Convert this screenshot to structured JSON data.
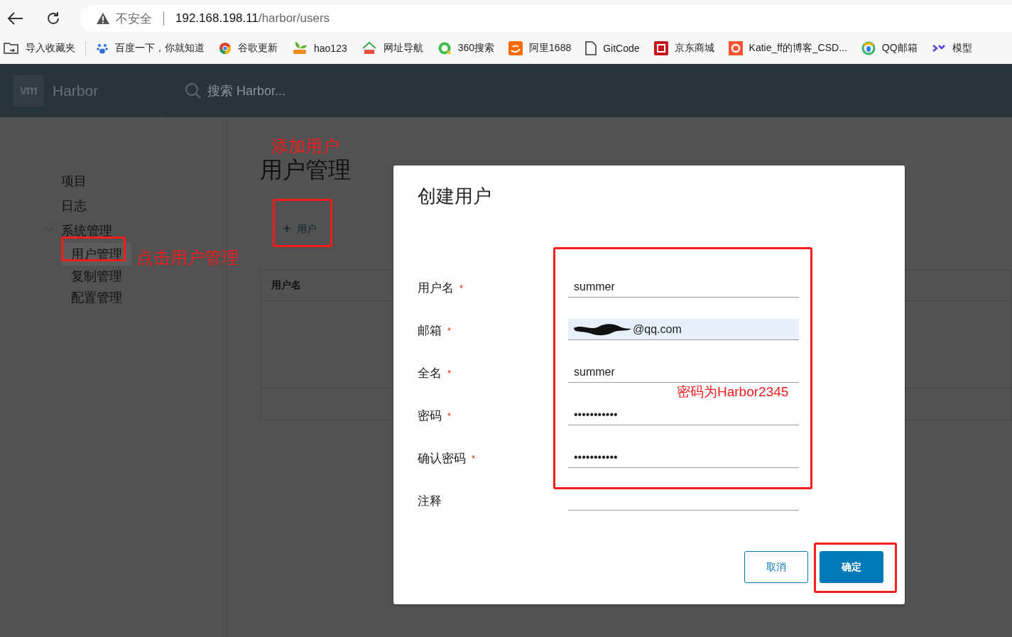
{
  "browser": {
    "address": {
      "warning": "不安全",
      "host": "192.168.198.11",
      "path": "/harbor/users"
    },
    "bookmarks": [
      {
        "label": "导入收藏夹",
        "kind": "folder"
      },
      {
        "label": "百度一下，你就知道",
        "kind": "paw"
      },
      {
        "label": "谷歌更新",
        "kind": "chrome"
      },
      {
        "label": "hao123",
        "kind": "leaf"
      },
      {
        "label": "网址导航",
        "kind": "house"
      },
      {
        "label": "360搜索",
        "kind": "ring"
      },
      {
        "label": "阿里1688",
        "kind": "ali"
      },
      {
        "label": "GitCode",
        "kind": "file"
      },
      {
        "label": "京东商城",
        "kind": "jd"
      },
      {
        "label": "Katie_ff的博客_CSD...",
        "kind": "csdn"
      },
      {
        "label": "QQ邮箱",
        "kind": "qq"
      },
      {
        "label": "模型",
        "kind": "zl"
      }
    ]
  },
  "header": {
    "logo": "vm",
    "brand": "Harbor",
    "search_placeholder": "搜索 Harbor..."
  },
  "sidebar": {
    "items": [
      {
        "label": "项目",
        "selected": false
      },
      {
        "label": "日志",
        "selected": false
      },
      {
        "label": "系统管理",
        "selected": false,
        "expanded": true,
        "children": [
          {
            "label": "用户管理",
            "selected": true
          },
          {
            "label": "复制管理",
            "selected": false
          },
          {
            "label": "配置管理",
            "selected": false
          }
        ]
      }
    ]
  },
  "main": {
    "title": "用户管理",
    "add_button": {
      "icon": "+",
      "label": "用户"
    },
    "table": {
      "columns": [
        "用户名"
      ]
    }
  },
  "dialog": {
    "title": "创建用户",
    "fields": [
      {
        "label": "用户名",
        "required_mark": "*",
        "value": "summer",
        "autofilled": false
      },
      {
        "label": "邮箱",
        "required_mark": "*",
        "value": "@qq.com",
        "autofilled": true,
        "redacted": true
      },
      {
        "label": "全名",
        "required_mark": "*",
        "value": "summer",
        "autofilled": false
      },
      {
        "label": "密码",
        "required_mark": "*",
        "value": "•••••••••••",
        "autofilled": false
      },
      {
        "label": "确认密码",
        "required_mark": "*",
        "value": "•••••••••••",
        "autofilled": false
      },
      {
        "label": "注释",
        "autofilled": false
      }
    ],
    "buttons": [
      {
        "label": "取消",
        "kind": "secondary"
      },
      {
        "label": "确定",
        "kind": "primary"
      }
    ]
  },
  "annotations": [
    {
      "kind": "note",
      "text": "添加用户"
    },
    {
      "kind": "note",
      "text": "点击用户管理"
    },
    {
      "kind": "note",
      "text": "密码为Harbor2345"
    },
    {
      "kind": "frame"
    },
    {
      "kind": "frame"
    },
    {
      "kind": "frame"
    },
    {
      "kind": "frame"
    }
  ]
}
